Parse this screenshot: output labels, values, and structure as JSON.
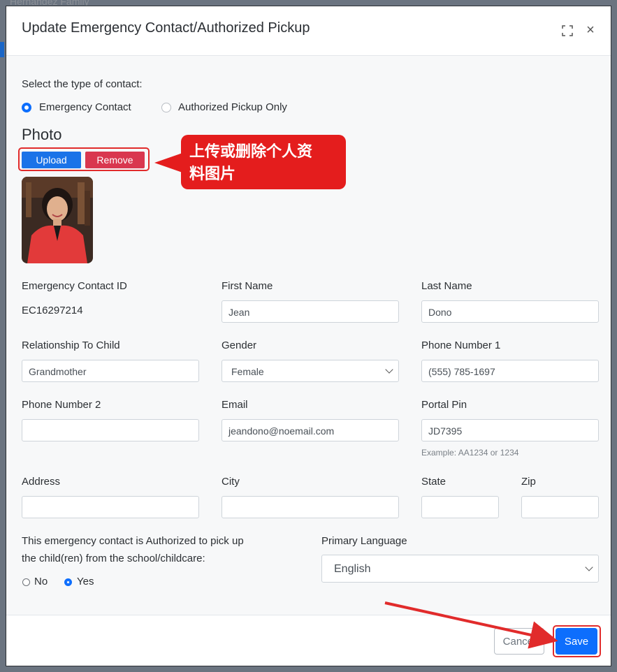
{
  "background": {
    "behind_text": "Hernandez Family"
  },
  "modal": {
    "title": "Update Emergency Contact/Authorized Pickup",
    "expand_icon": "expand-icon",
    "close_label": "×"
  },
  "contact_type": {
    "label": "Select the type of contact:",
    "options": [
      {
        "label": "Emergency Contact",
        "selected": true
      },
      {
        "label": "Authorized Pickup Only",
        "selected": false
      }
    ]
  },
  "photo": {
    "title": "Photo",
    "upload_label": "Upload",
    "remove_label": "Remove"
  },
  "annotation": {
    "callout_line1": "上传或删除个人资",
    "callout_line2": "料图片",
    "color": "#e41d1d"
  },
  "fields": {
    "emergency_contact_id": {
      "label": "Emergency Contact ID",
      "value": "EC16297214"
    },
    "first_name": {
      "label": "First Name",
      "value": "Jean"
    },
    "last_name": {
      "label": "Last Name",
      "value": "Dono"
    },
    "relationship": {
      "label": "Relationship To Child",
      "value": "Grandmother"
    },
    "gender": {
      "label": "Gender",
      "value": "Female"
    },
    "phone1": {
      "label": "Phone Number 1",
      "value": "(555) 785-1697"
    },
    "phone2": {
      "label": "Phone Number 2",
      "value": ""
    },
    "email": {
      "label": "Email",
      "value": "jeandono@noemail.com"
    },
    "portal_pin": {
      "label": "Portal Pin",
      "value": "JD7395",
      "hint": "Example: AA1234 or 1234"
    },
    "address": {
      "label": "Address",
      "value": ""
    },
    "city": {
      "label": "City",
      "value": ""
    },
    "state": {
      "label": "State",
      "value": ""
    },
    "zip": {
      "label": "Zip",
      "value": ""
    }
  },
  "authorized": {
    "question_line1": "This emergency contact is Authorized to pick up",
    "question_line2": "the child(ren) from the school/childcare:",
    "options": [
      {
        "label": "No",
        "selected": false
      },
      {
        "label": "Yes",
        "selected": true
      }
    ]
  },
  "primary_language": {
    "label": "Primary Language",
    "value": "English"
  },
  "footer": {
    "cancel_label": "Cancel",
    "save_label": "Save"
  },
  "colors": {
    "primary": "#0d6efd",
    "danger": "#d9374f",
    "annotation_red": "#e12b2b"
  }
}
